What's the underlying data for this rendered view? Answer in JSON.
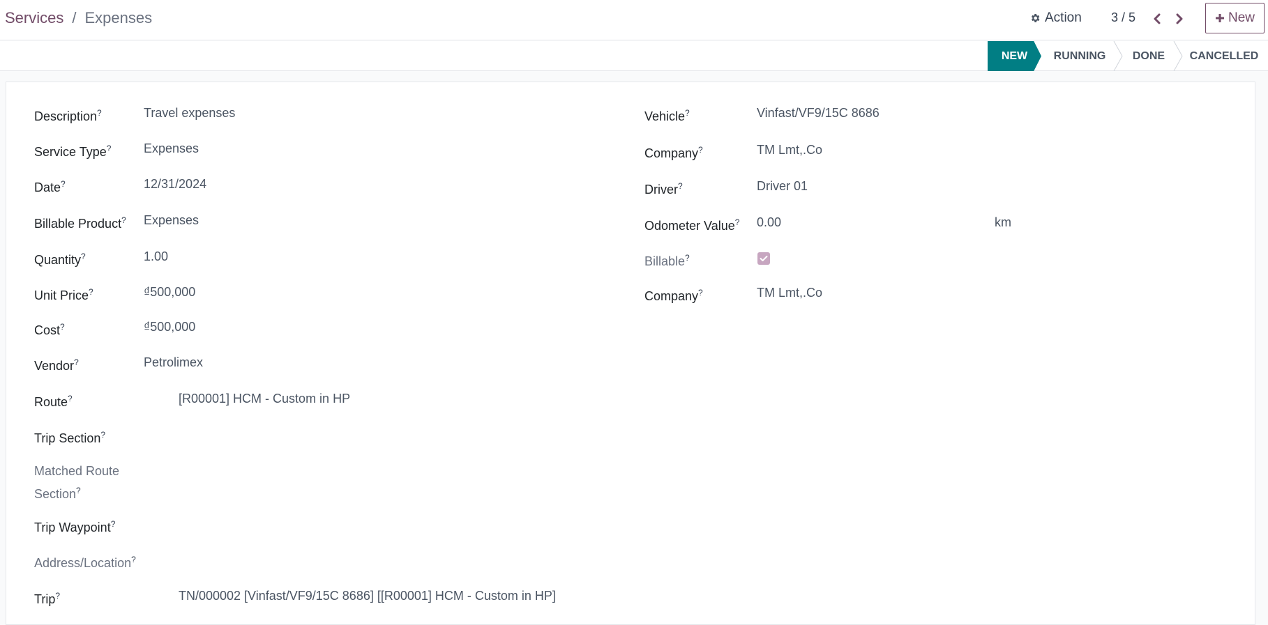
{
  "breadcrumb": {
    "parent": "Services",
    "separator": "/",
    "current": "Expenses"
  },
  "toolbar": {
    "action_label": "Action",
    "pager": "3 / 5",
    "new_label": "New",
    "icons": {
      "action": "gear-icon",
      "prev": "chevron-left-icon",
      "next": "chevron-right-icon",
      "new": "plus-icon"
    }
  },
  "statusbar": {
    "stages": [
      {
        "label": "NEW",
        "active": true
      },
      {
        "label": "RUNNING",
        "active": false
      },
      {
        "label": "DONE",
        "active": false
      },
      {
        "label": "CANCELLED",
        "active": false
      }
    ],
    "active_color": "#017e84"
  },
  "form": {
    "left": {
      "description": {
        "label": "Description",
        "value": "Travel expenses"
      },
      "service_type": {
        "label": "Service Type",
        "value": "Expenses"
      },
      "date": {
        "label": "Date",
        "value": "12/31/2024"
      },
      "billable_product": {
        "label": "Billable Product",
        "value": "Expenses"
      },
      "quantity": {
        "label": "Quantity",
        "value": "1.00"
      },
      "unit_price": {
        "label": "Unit Price",
        "value": "₫500,000"
      },
      "cost": {
        "label": "Cost",
        "value": "₫500,000"
      },
      "vendor": {
        "label": "Vendor",
        "value": "Petrolimex"
      },
      "route": {
        "label": "Route",
        "value": "[R00001] HCM - Custom in HP"
      },
      "trip_section": {
        "label": "Trip Section",
        "value": ""
      },
      "matched_route_section": {
        "label_line1": "Matched Route",
        "label_line2": "Section",
        "value": ""
      },
      "trip_waypoint": {
        "label": "Trip Waypoint",
        "value": ""
      },
      "address_location": {
        "label": "Address/Location",
        "value": ""
      },
      "trip": {
        "label": "Trip",
        "value": "TN/000002 [Vinfast/VF9/15C 8686] [[R00001] HCM - Custom in HP]"
      }
    },
    "right": {
      "vehicle": {
        "label": "Vehicle",
        "value": "Vinfast/VF9/15C 8686"
      },
      "company": {
        "label": "Company",
        "value": "TM Lmt,.Co"
      },
      "driver": {
        "label": "Driver",
        "value": "Driver 01"
      },
      "odometer": {
        "label": "Odometer Value",
        "value": "0.00",
        "unit": "km"
      },
      "billable": {
        "label": "Billable",
        "checked": true
      },
      "company2": {
        "label": "Company",
        "value": "TM Lmt,.Co"
      }
    },
    "help_marker": "?",
    "accent_color": "#714b67"
  }
}
